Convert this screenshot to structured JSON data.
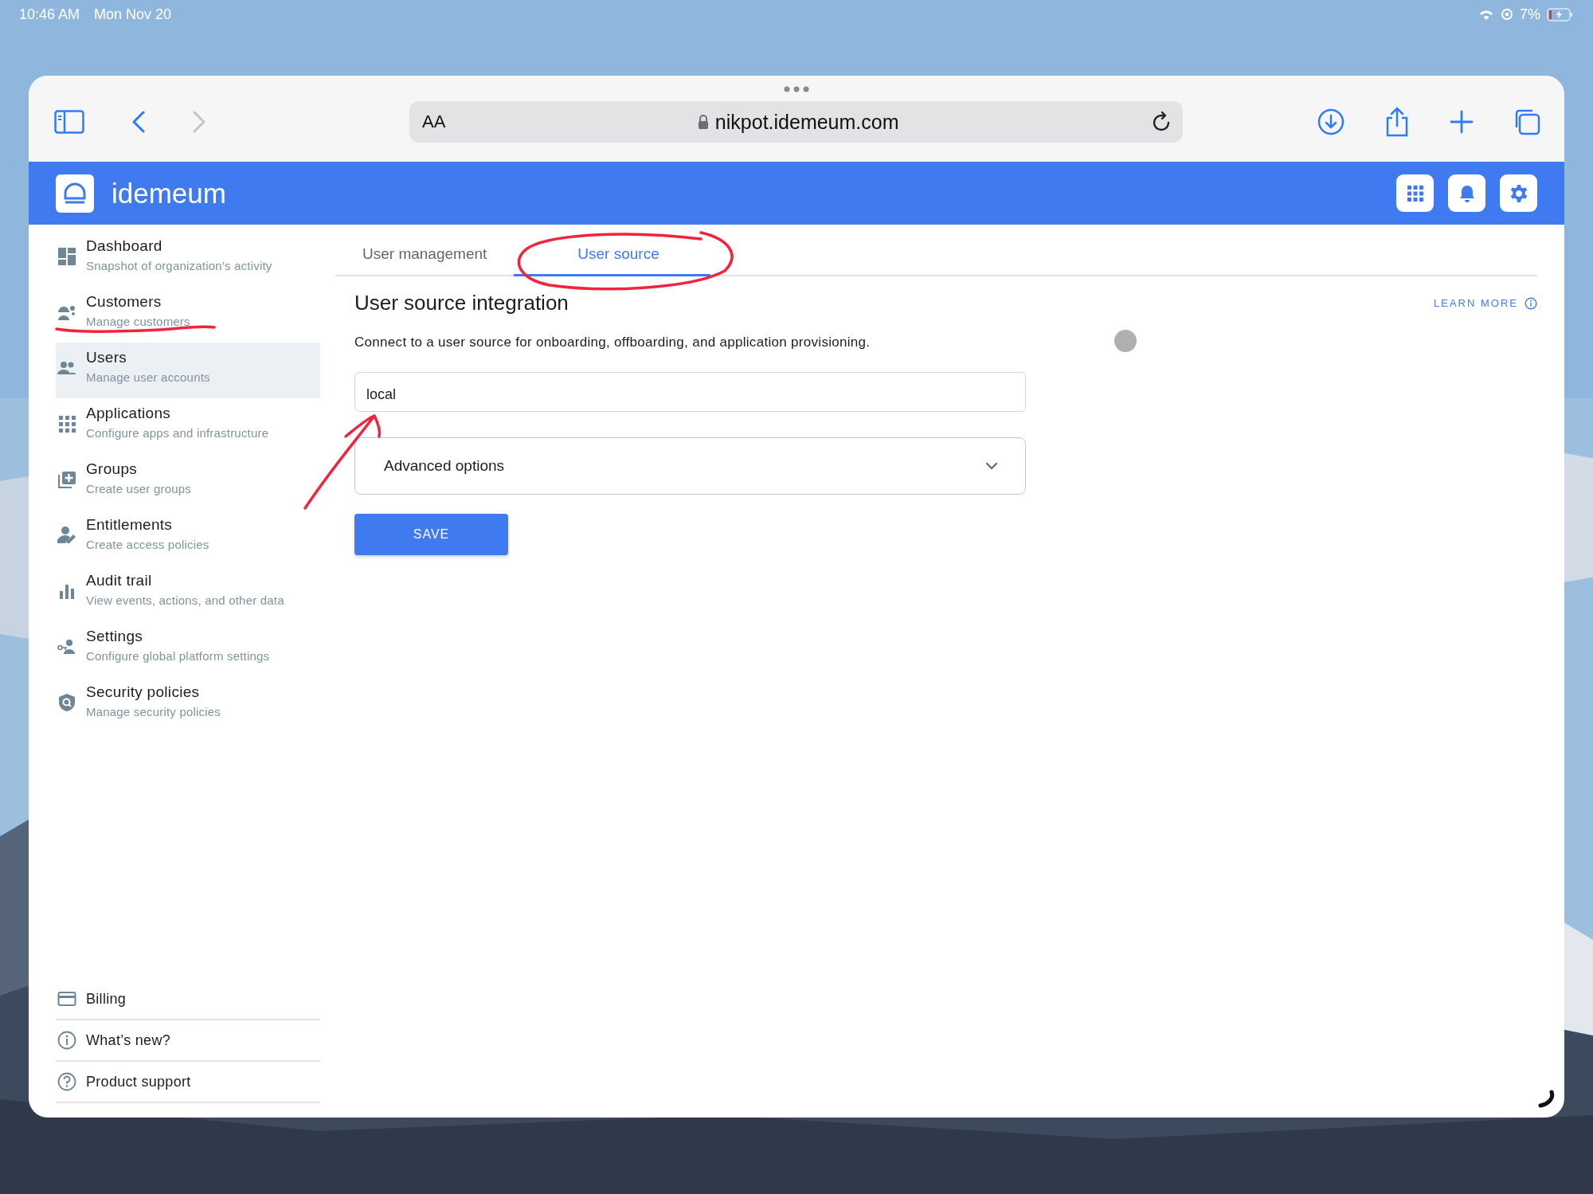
{
  "status_bar": {
    "time": "10:46 AM",
    "date": "Mon Nov 20",
    "battery": "7%"
  },
  "browser": {
    "text_size_button": "AA",
    "address": "nikpot.idemeum.com"
  },
  "app": {
    "brand": "idemeum"
  },
  "sidebar": {
    "items": [
      {
        "title": "Dashboard",
        "subtitle": "Snapshot of organization’s activity",
        "selected": false
      },
      {
        "title": "Customers",
        "subtitle": "Manage customers",
        "selected": false
      },
      {
        "title": "Users",
        "subtitle": "Manage user accounts",
        "selected": true
      },
      {
        "title": "Applications",
        "subtitle": "Configure apps and infrastructure",
        "selected": false
      },
      {
        "title": "Groups",
        "subtitle": "Create user groups",
        "selected": false
      },
      {
        "title": "Entitlements",
        "subtitle": "Create access policies",
        "selected": false
      },
      {
        "title": "Audit trail",
        "subtitle": "View events, actions, and other data",
        "selected": false
      },
      {
        "title": "Settings",
        "subtitle": "Configure global platform settings",
        "selected": false
      },
      {
        "title": "Security policies",
        "subtitle": "Manage security policies",
        "selected": false
      }
    ],
    "footer_items": [
      {
        "label": "Billing"
      },
      {
        "label": "What’s new?"
      },
      {
        "label": "Product support"
      }
    ]
  },
  "tabs": [
    {
      "label": "User management",
      "selected": false
    },
    {
      "label": "User source",
      "selected": true
    }
  ],
  "section": {
    "title": "User source integration",
    "learn_more": "LEARN MORE",
    "description": "Connect to a user source for onboarding, offboarding, and application provisioning."
  },
  "source_field": {
    "value": "local"
  },
  "advanced_options": {
    "label": "Advanced options",
    "expanded": false
  },
  "save_button": "SAVE"
}
